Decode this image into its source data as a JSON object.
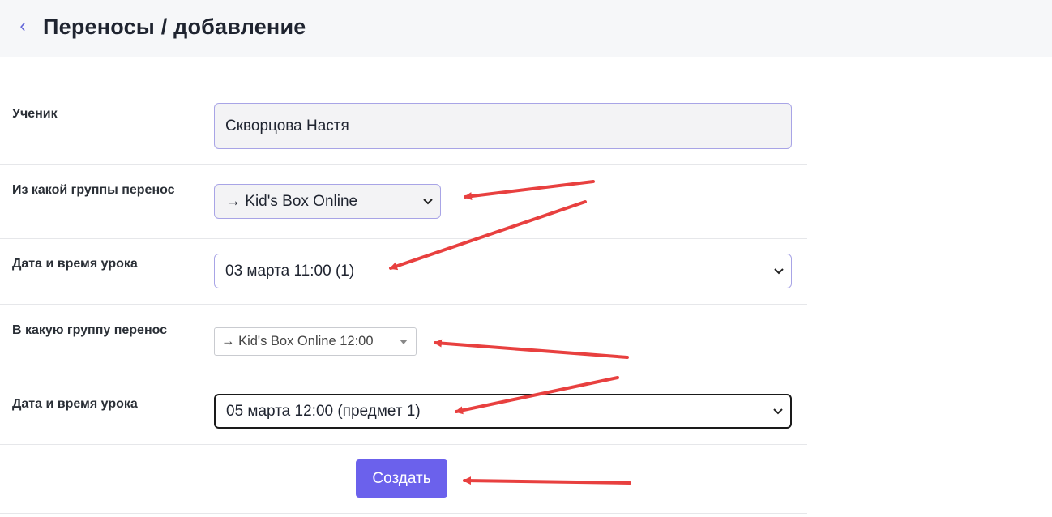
{
  "header": {
    "back_icon": "chevron-left-icon",
    "title": "Переносы / добавление"
  },
  "form": {
    "student": {
      "label": "Ученик",
      "value": "Скворцова Настя"
    },
    "from_group": {
      "label": "Из какой группы перенос",
      "value": "→ Kid's Box Online"
    },
    "from_lesson": {
      "label": "Дата и время урока",
      "value": "03 марта 11:00 (1)"
    },
    "to_group": {
      "label": "В какую группу перенос",
      "value": "→ Kid's Box Online 12:00"
    },
    "to_lesson": {
      "label": "Дата и время урока",
      "value": "05 марта 12:00 (предмет 1)"
    },
    "submit_label": "Создать"
  },
  "colors": {
    "accent": "#6b61ec",
    "annotation_arrow": "#e8403f",
    "header_bg": "#f6f7f9"
  }
}
